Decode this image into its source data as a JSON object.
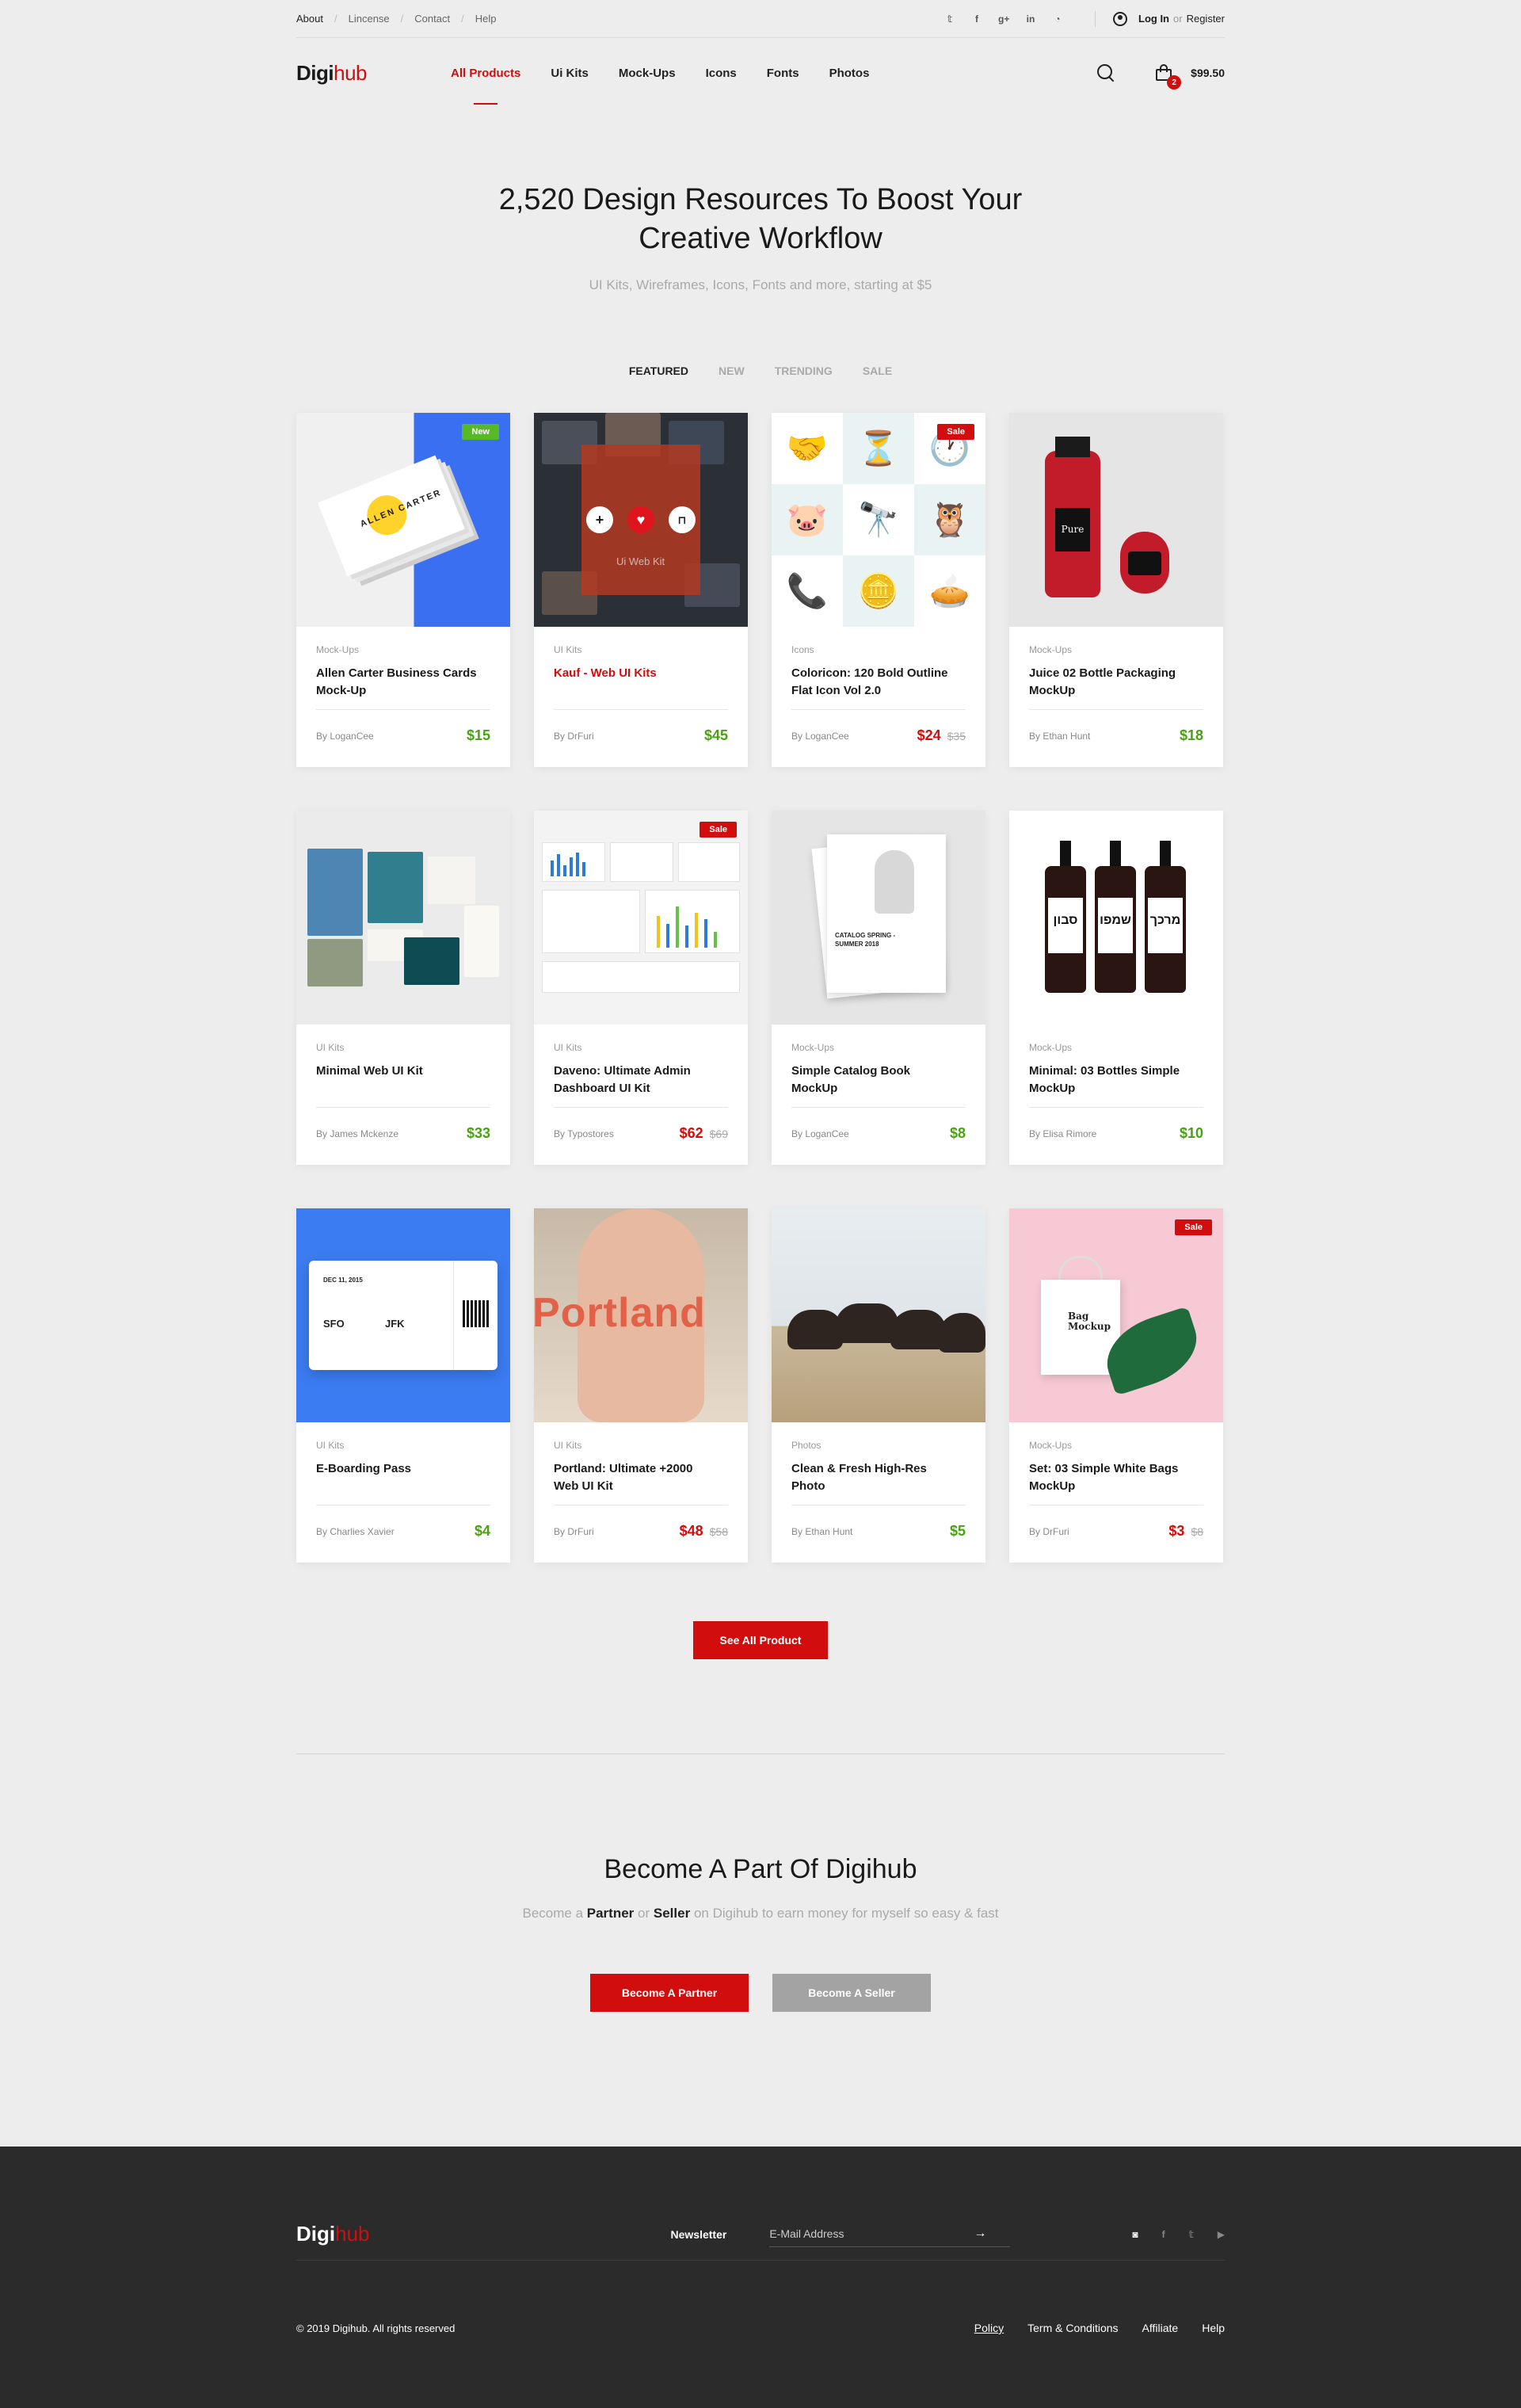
{
  "topbar": {
    "links": [
      "About",
      "Lincense",
      "Contact",
      "Help"
    ],
    "social_icons": [
      "twitter-icon",
      "facebook-icon",
      "google-plus-icon",
      "linkedin-icon",
      "rss-icon"
    ],
    "social_glyphs": [
      "𝕥",
      "f",
      "g+",
      "in",
      "◔"
    ],
    "login": "Log In",
    "or": "or",
    "register": "Register"
  },
  "nav": {
    "logo_main": "Digi",
    "logo_accent": "hub",
    "items": [
      "All Products",
      "Ui Kits",
      "Mock-Ups",
      "Icons",
      "Fonts",
      "Photos"
    ],
    "active_index": 0,
    "cart_count": "2",
    "cart_total": "$99.50"
  },
  "hero": {
    "title": "2,520 Design Resources To Boost Your Creative Workflow",
    "subtitle": "UI Kits, Wireframes, Icons, Fonts and more, starting at $5"
  },
  "tabs": [
    "FEATURED",
    "NEW",
    "TRENDING",
    "SALE"
  ],
  "products": [
    {
      "category": "Mock-Ups",
      "title": "Allen Carter Business Cards Mock-Up",
      "author": "By LoganCee",
      "price": "$15",
      "old_price": "",
      "badge": "New",
      "price_color": "green",
      "title_red": false
    },
    {
      "category": "UI Kits",
      "title": "Kauf - Web UI Kits",
      "author": "By DrFuri",
      "price": "$45",
      "old_price": "",
      "badge": "",
      "price_color": "green",
      "title_red": true
    },
    {
      "category": "Icons",
      "title": "Coloricon: 120 Bold Outline Flat Icon Vol 2.0",
      "author": "By LoganCee",
      "price": "$24",
      "old_price": "$35",
      "badge": "Sale",
      "price_color": "red",
      "title_red": false
    },
    {
      "category": "Mock-Ups",
      "title": "Juice 02 Bottle Packaging MockUp",
      "author": "By Ethan Hunt",
      "price": "$18",
      "old_price": "",
      "badge": "",
      "price_color": "green",
      "title_red": false
    },
    {
      "category": "UI Kits",
      "title": "Minimal Web UI Kit",
      "author": "By James Mckenze",
      "price": "$33",
      "old_price": "",
      "badge": "",
      "price_color": "green",
      "title_red": false
    },
    {
      "category": "UI Kits",
      "title": "Daveno: Ultimate Admin Dashboard UI Kit",
      "author": "By Typostores",
      "price": "$62",
      "old_price": "$69",
      "badge": "Sale",
      "price_color": "red",
      "title_red": false
    },
    {
      "category": "Mock-Ups",
      "title": "Simple Catalog Book MockUp",
      "author": "By LoganCee",
      "price": "$8",
      "old_price": "",
      "badge": "",
      "price_color": "green",
      "title_red": false
    },
    {
      "category": "Mock-Ups",
      "title": "Minimal: 03 Bottles Simple MockUp",
      "author": "By Elisa Rimore",
      "price": "$10",
      "old_price": "",
      "badge": "",
      "price_color": "green",
      "title_red": false
    },
    {
      "category": "UI Kits",
      "title": "E-Boarding Pass",
      "author": "By Charlies Xavier",
      "price": "$4",
      "old_price": "",
      "badge": "",
      "price_color": "green",
      "title_red": false
    },
    {
      "category": "UI Kits",
      "title": "Portland: Ultimate +2000 Web UI Kit",
      "author": "By DrFuri",
      "price": "$48",
      "old_price": "$58",
      "badge": "",
      "price_color": "red",
      "title_red": false
    },
    {
      "category": "Photos",
      "title": "Clean & Fresh High-Res Photo",
      "author": "By Ethan Hunt",
      "price": "$5",
      "old_price": "",
      "badge": "",
      "price_color": "green",
      "title_red": false
    },
    {
      "category": "Mock-Ups",
      "title": "Set: 03 Simple White Bags MockUp",
      "author": "By DrFuri",
      "price": "$3",
      "old_price": "$8",
      "badge": "Sale",
      "price_color": "red",
      "title_red": false
    }
  ],
  "thumb_text": {
    "card_name": "ALLEN CARTER",
    "kauf": "Ui Web Kit",
    "juice_label": "Pure",
    "catalog": "CATALOG SPRING - SUMMER 2018",
    "bottle_labels": [
      "סבון",
      "שמפו",
      "מרכך"
    ],
    "pass_date": "DEC 11, 2015",
    "pass_from": "SFO",
    "pass_to": "JFK",
    "portland": "Portland",
    "bag": "Bag Mockup",
    "icons": [
      "🤝",
      "⏳",
      "🕐",
      "🐷",
      "🔭",
      "🦉",
      "📞",
      "🪙",
      "🥧"
    ]
  },
  "see_all": "See All Product",
  "become": {
    "title": "Become A Part Of Digihub",
    "text_pre": "Become a",
    "partner": "Partner",
    "or": "or",
    "seller": "Seller",
    "text_post": "on Digihub to earn money for myself so easy & fast",
    "btn_partner": "Become A Partner",
    "btn_seller": "Become A Seller"
  },
  "footer": {
    "logo_main": "Digi",
    "logo_accent": "hub",
    "newsletter": "Newsletter",
    "email_placeholder": "E-Mail Address",
    "social_icons": [
      "instagram-icon",
      "facebook-icon",
      "twitter-icon",
      "youtube-icon"
    ],
    "social_glyphs": [
      "◙",
      "f",
      "𝕥",
      "▶"
    ],
    "copyright": "© 2019 Digihub. All rights reserved",
    "links": [
      "Policy",
      "Term & Conditions",
      "Affiliate",
      "Help"
    ]
  },
  "colors": {
    "accent": "#d10d0d",
    "price_green": "#4aa112",
    "new_badge": "#58b928",
    "footer_bg": "#2b2b2b"
  }
}
